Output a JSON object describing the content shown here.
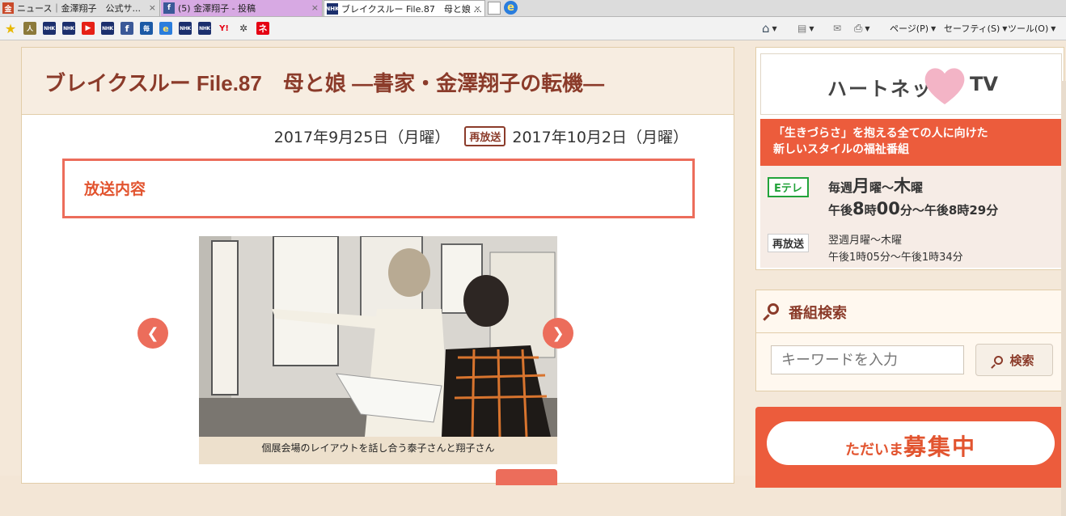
{
  "browser": {
    "tabs": [
      {
        "label": "ニュース｜金澤翔子　公式サ...",
        "close": "×"
      },
      {
        "label": "(5) 金澤翔子 - 投稿",
        "close": "×"
      },
      {
        "label": "ブレイクスルー File.87　母と娘 ...",
        "close": "×"
      }
    ],
    "favorites": [
      "NHK",
      "NHK",
      "NHK",
      "NHK",
      "NHK",
      "NHK"
    ],
    "commands": {
      "page": "ページ(P)",
      "safety": "セーフティ(S)",
      "tools": "ツール(O)"
    }
  },
  "page": {
    "title": "ブレイクスルー File.87　母と娘 ―書家・金澤翔子の転機―",
    "broadcast_date": "2017年9月25日（月曜）",
    "rerun_badge": "再放送",
    "rerun_date": "2017年10月2日（月曜）",
    "section_title": "放送内容",
    "slide_caption": "個展会場のレイアウトを話し合う泰子さんと翔子さん",
    "prev_arrow": "❮",
    "next_arrow": "❯"
  },
  "sidebar": {
    "logo_left": "ハートネット",
    "logo_right": "TV",
    "tagline_1": "「生きづらさ」を抱える全ての人に向けた",
    "tagline_2": "新しいスタイルの福祉番組",
    "channel": "Eテレ",
    "schedule_line1_pre": "毎週",
    "schedule_day1": "月",
    "schedule_mid": "曜～",
    "schedule_day2": "木",
    "schedule_post": "曜",
    "schedule_line2_a": "午後",
    "schedule_h1": "8",
    "schedule_t1": "時",
    "schedule_m1": "00",
    "schedule_t2": "分～午後8時29分",
    "rerun_label": "再放送",
    "rerun_line1": "翌週月曜～木曜",
    "rerun_line2": "午後1時05分～午後1時34分",
    "search_heading": "番組検索",
    "search_placeholder": "キーワードを入力",
    "search_button": "検索",
    "recruit_small": "ただいま",
    "recruit_big": "募集中"
  },
  "colors": {
    "accent": "#ec6d5b",
    "title": "#8b3b2a",
    "etele": "#22a33a"
  }
}
